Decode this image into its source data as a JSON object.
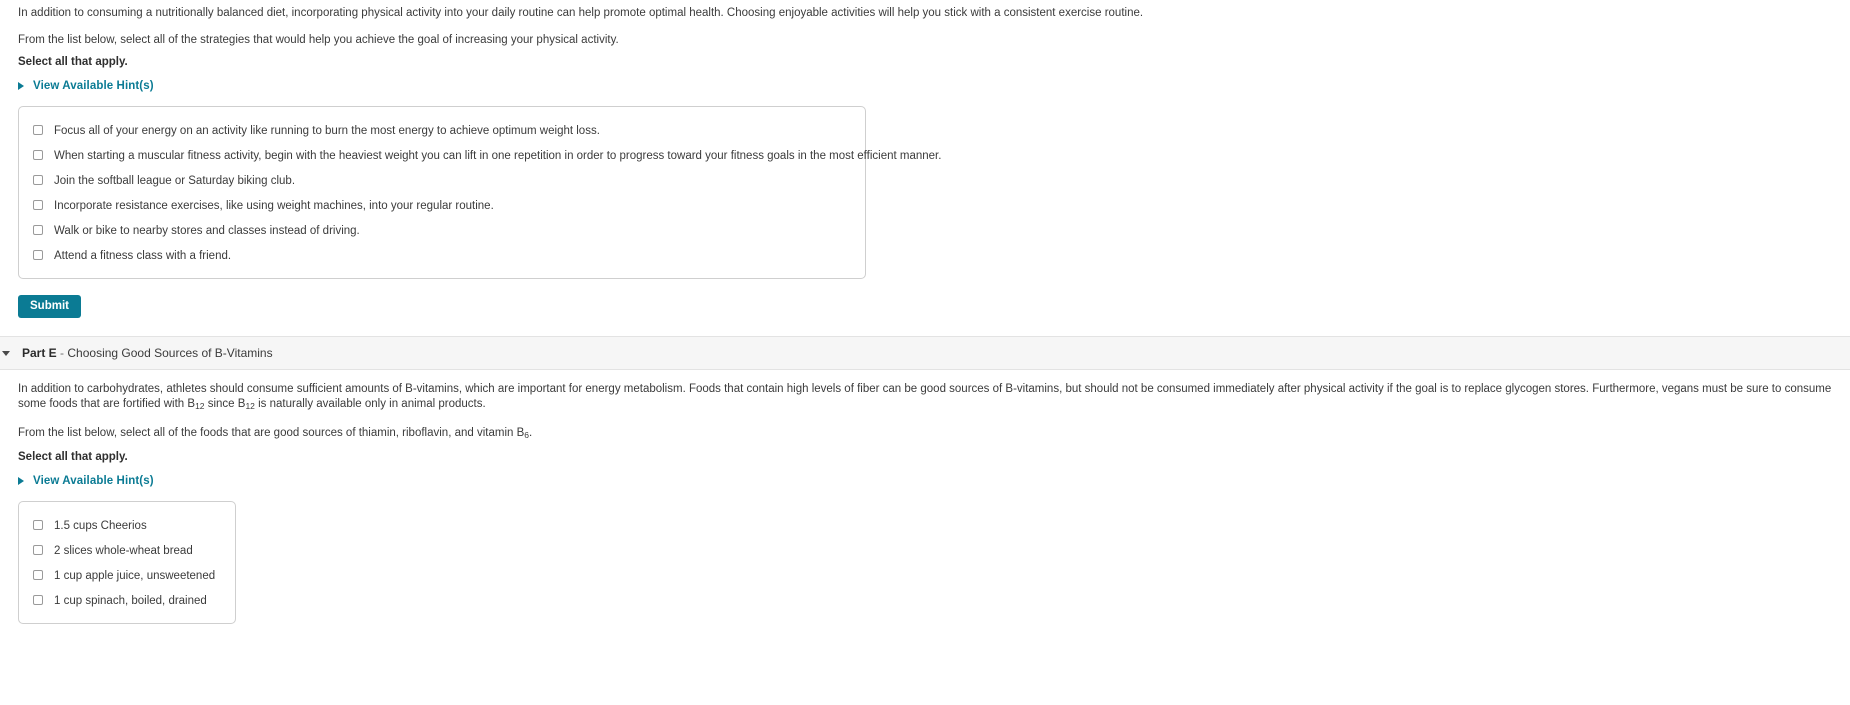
{
  "colors": {
    "accent": "#0b7b94",
    "text": "#3b3b3b",
    "band": "#f6f6f6",
    "border": "#cfcfcf"
  },
  "partD": {
    "intro_paragraph": "In addition to consuming a nutritionally balanced diet, incorporating physical activity into your daily routine can help promote optimal health. Choosing enjoyable activities will help you stick with a consistent exercise routine.",
    "prompt": "From the list below, select all of the strategies that would help you achieve the goal of increasing your physical activity.",
    "select_all": "Select all that apply.",
    "hint_label": "View Available Hint(s)",
    "choices": [
      "Focus all of your energy on an activity like running to burn the most energy to achieve optimum weight loss.",
      "When starting a muscular fitness activity, begin with the heaviest weight you can lift in one repetition in order to progress toward your fitness goals in the most efficient manner.",
      "Join the softball league or Saturday biking club.",
      "Incorporate resistance exercises, like using weight machines, into your regular routine.",
      "Walk or bike to nearby stores and classes instead of driving.",
      "Attend a fitness class with a friend."
    ],
    "submit_label": "Submit"
  },
  "partE": {
    "part_name": "Part E",
    "dash": "-",
    "title": "Choosing Good Sources of B-Vitamins",
    "paragraph_pre": "In addition to carbohydrates, athletes should consume sufficient amounts of B-vitamins, which are important for energy metabolism. Foods that contain high levels of fiber can be good sources of B-vitamins, but should not be consumed immediately after physical activity if the goal is to replace glycogen stores. Furthermore, vegans must be sure to consume some foods that are fortified with B",
    "sub1": "12",
    "paragraph_mid": " since B",
    "sub2": "12",
    "paragraph_post": " is naturally available only in animal products.",
    "prompt_pre": "From the list below, select all of the foods that are good sources of thiamin, riboflavin, and vitamin B",
    "prompt_sub": "6",
    "prompt_post": ".",
    "select_all": "Select all that apply.",
    "hint_label": "View Available Hint(s)",
    "choices": [
      "1.5 cups Cheerios",
      "2 slices whole-wheat bread",
      "1 cup apple juice, unsweetened",
      "1 cup spinach, boiled, drained"
    ]
  }
}
